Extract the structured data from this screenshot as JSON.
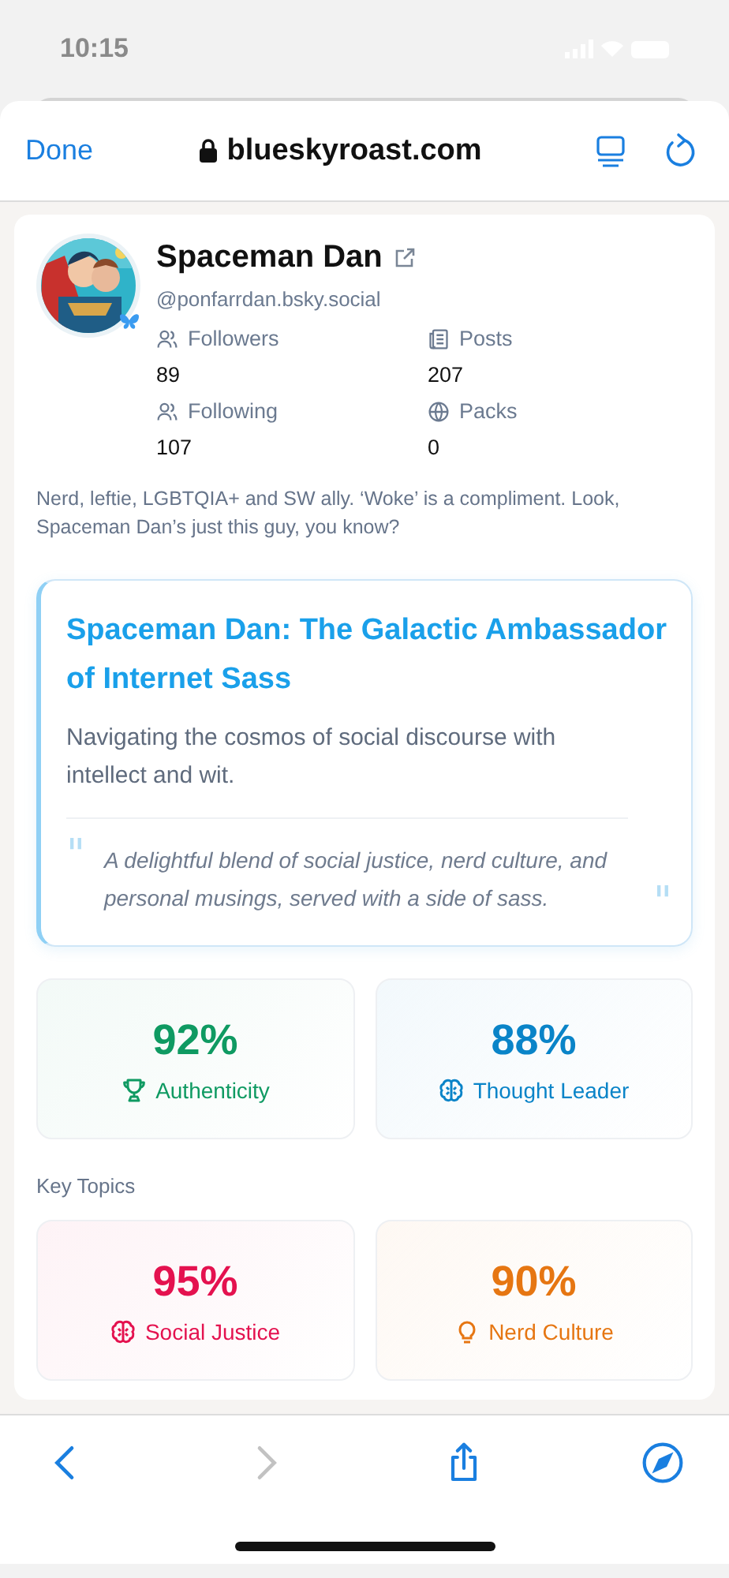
{
  "status_bar": {
    "time": "10:15"
  },
  "browser": {
    "done": "Done",
    "url": "blueskyroast.com"
  },
  "profile": {
    "name": "Spaceman Dan",
    "handle": "@ponfarrdan.bsky.social",
    "stats": [
      {
        "kind": "people",
        "label": "Followers",
        "value": "89"
      },
      {
        "kind": "posts",
        "label": "Posts",
        "value": "207"
      },
      {
        "kind": "people",
        "label": "Following",
        "value": "107"
      },
      {
        "kind": "globe",
        "label": "Packs",
        "value": "0"
      }
    ],
    "bio": "Nerd, leftie, LGBTQIA+ and SW ally. ‘Woke’ is a compliment. Look, Spaceman Dan’s just this guy, you know?"
  },
  "summary": {
    "title": "Spaceman Dan: The Galactic Ambassador of Internet Sass",
    "subtitle": "Navigating the cosmos of social discourse with intellect and wit.",
    "quote_open": "\"",
    "quote": "A delightful blend of social justice, nerd culture, and personal musings, served with a side of sass.",
    "quote_close": "\""
  },
  "scores": [
    {
      "kind": "trophy",
      "value": "92%",
      "label": "Authenticity",
      "color": "#0f9a62"
    },
    {
      "kind": "brain",
      "value": "88%",
      "label": "Thought Leader",
      "color": "#0a84c8"
    }
  ],
  "key_topics": {
    "heading": "Key Topics",
    "items": [
      {
        "kind": "brain",
        "value": "95%",
        "label": "Social Justice",
        "color": "#e4124f"
      },
      {
        "kind": "bulb",
        "value": "90%",
        "label": "Nerd Culture",
        "color": "#e67612"
      }
    ]
  },
  "toolbar": [
    {
      "kind": "back",
      "disabled": false
    },
    {
      "kind": "forward",
      "disabled": true
    },
    {
      "kind": "share",
      "disabled": false
    },
    {
      "kind": "compass",
      "disabled": false
    }
  ]
}
